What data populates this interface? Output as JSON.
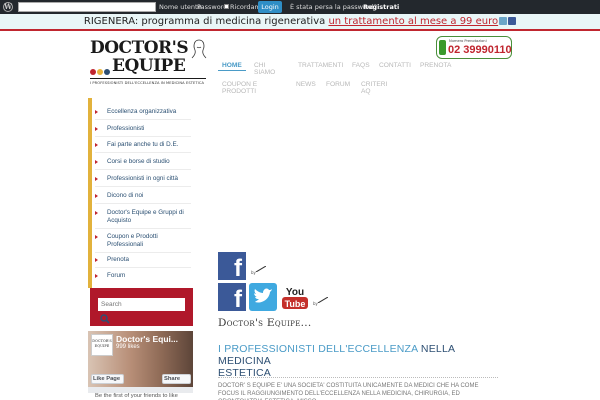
{
  "adminbar": {
    "wp_logo_glyph": "W",
    "username_label": "Nome utente",
    "password_label": "Password",
    "remember_label": "Ricordami",
    "login_label": "Login",
    "lost_password": "È stata persa la password?",
    "register": "Registrati"
  },
  "banner": {
    "prefix": "RIGENERA: programma di medicina rigenerativa ",
    "link": "un trattamento al mese a 99 euro"
  },
  "logo": {
    "line1": "DOCTOR'S",
    "line2": "EQUIPE",
    "tagline": "I PROFESSIONISTI DELL'ECCELLENZA IN MEDICINA ESTETICA"
  },
  "phone": {
    "small": "Numero Prenotazioni",
    "number": "02 39990110"
  },
  "nav": {
    "home": "HOME",
    "chi": "CHI",
    "siamo": "SIAMO",
    "trattamenti": "TRATTAMENTI",
    "faqs": "FAQS",
    "contatti": "CONTATTI",
    "prenota": "PRENOTA",
    "coupon": "COUPON E",
    "prodotti": "PRODOTTI",
    "news": "NEWS",
    "forum": "FORUM",
    "criteri": "CRITERI",
    "aq": "AQ"
  },
  "sidebar": {
    "items": [
      {
        "label": "Eccellenza organizzativa"
      },
      {
        "label": "Professionisti"
      },
      {
        "label": "Fai parte anche tu di D.E."
      },
      {
        "label": "Corsi e borse di studio"
      },
      {
        "label": "Professionisti in ogni città"
      },
      {
        "label": "Dicono di noi"
      },
      {
        "label": "Doctor's Equipe e Gruppi di Acquisto"
      },
      {
        "label": "Coupon e Prodotti Professionali"
      },
      {
        "label": "Prenota"
      },
      {
        "label": "Forum"
      }
    ]
  },
  "search": {
    "placeholder": "Search"
  },
  "fb": {
    "thumb": "DOCTOR'S EQUIPE",
    "name": "Doctor's Equi...",
    "likes": "999 likes",
    "like_btn": "Like Page",
    "share_btn": "Share",
    "foot": "Be the first of your friends to like"
  },
  "social": {
    "by": "by",
    "fb_glyph": "f",
    "yt_top": "You",
    "yt_bottom": "Tube"
  },
  "content": {
    "brand": "Doctor's Equipe...",
    "head_a": "I PROFESSIONISTI DELL'ECCELLENZA ",
    "head_b": "NELLA MEDICINA",
    "head_c": "ESTETICA",
    "body": "DOCTOR' S EQUIPE E' UNA SOCIETA' COSTITUITA UNICAMENTE DA MEDICI CHE HA COME FOCUS IL RAGGIUNGIMENTO DELL'ECCELLENZA NELLA MEDICINA, CHIRURGIA, ED ODONTOIATRIA ESTETICA. Misso"
  },
  "colors": {
    "accent_blue": "#4a9bc7",
    "brand_red": "#c0262f",
    "facebook_blue": "#3b5998",
    "twitter_blue": "#3fa9e0",
    "sidebar_accent": "#e2b23c"
  },
  "icons": {
    "wp": "wordpress-icon",
    "search": "search-icon",
    "phone": "phone-icon"
  }
}
